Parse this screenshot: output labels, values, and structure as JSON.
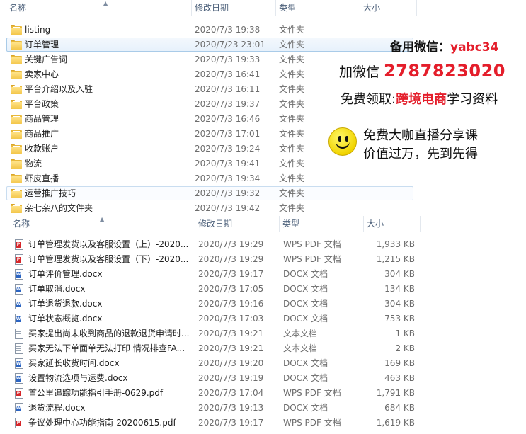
{
  "pane1": {
    "columns": {
      "name": "名称",
      "date": "修改日期",
      "type": "类型",
      "size": "大小"
    },
    "rows": [
      {
        "name": "listing",
        "date": "2020/7/3 19:38",
        "type": "文件夹",
        "state": "normal"
      },
      {
        "name": "订单管理",
        "date": "2020/7/23 23:01",
        "type": "文件夹",
        "state": "selected"
      },
      {
        "name": "关键广告词",
        "date": "2020/7/3 19:33",
        "type": "文件夹",
        "state": "normal"
      },
      {
        "name": "卖家中心",
        "date": "2020/7/3 16:41",
        "type": "文件夹",
        "state": "normal"
      },
      {
        "name": "平台介绍以及入驻",
        "date": "2020/7/3 16:11",
        "type": "文件夹",
        "state": "normal"
      },
      {
        "name": "平台政策",
        "date": "2020/7/3 19:37",
        "type": "文件夹",
        "state": "normal"
      },
      {
        "name": "商品管理",
        "date": "2020/7/3 16:46",
        "type": "文件夹",
        "state": "normal"
      },
      {
        "name": "商品推广",
        "date": "2020/7/3 17:01",
        "type": "文件夹",
        "state": "normal"
      },
      {
        "name": "收款账户",
        "date": "2020/7/3 19:24",
        "type": "文件夹",
        "state": "normal"
      },
      {
        "name": "物流",
        "date": "2020/7/3 19:41",
        "type": "文件夹",
        "state": "normal"
      },
      {
        "name": "虾皮直播",
        "date": "2020/7/3 19:34",
        "type": "文件夹",
        "state": "normal"
      },
      {
        "name": "运营推广技巧",
        "date": "2020/7/3 19:32",
        "type": "文件夹",
        "state": "highlight"
      },
      {
        "name": "杂七杂八的文件夹",
        "date": "2020/7/3 19:42",
        "type": "文件夹",
        "state": "normal"
      }
    ]
  },
  "pane2": {
    "columns": {
      "name": "名称",
      "date": "修改日期",
      "type": "类型",
      "size": "大小"
    },
    "rows": [
      {
        "name": "订单管理发货以及客服设置（上）-2020...",
        "date": "2020/7/3 19:29",
        "type": "WPS PDF 文档",
        "size": "1,933 KB",
        "icon": "pdf-icon"
      },
      {
        "name": "订单管理发货以及客服设置（下）-2020...",
        "date": "2020/7/3 19:29",
        "type": "WPS PDF 文档",
        "size": "1,215 KB",
        "icon": "pdf-icon"
      },
      {
        "name": "订单评价管理.docx",
        "date": "2020/7/3 19:17",
        "type": "DOCX 文档",
        "size": "304 KB",
        "icon": "word-icon"
      },
      {
        "name": "订单取消.docx",
        "date": "2020/7/3 17:05",
        "type": "DOCX 文档",
        "size": "134 KB",
        "icon": "word-icon"
      },
      {
        "name": "订单退货退款.docx",
        "date": "2020/7/3 19:16",
        "type": "DOCX 文档",
        "size": "304 KB",
        "icon": "word-icon"
      },
      {
        "name": "订单状态概览.docx",
        "date": "2020/7/3 17:03",
        "type": "DOCX 文档",
        "size": "753 KB",
        "icon": "word-icon"
      },
      {
        "name": "买家提出尚未收到商品的退款退货申请时...",
        "date": "2020/7/3 19:21",
        "type": "文本文档",
        "size": "1 KB",
        "icon": "text-icon"
      },
      {
        "name": "买家无法下单面单无法打印 情况排查FA...",
        "date": "2020/7/3 19:21",
        "type": "文本文档",
        "size": "2 KB",
        "icon": "text-icon"
      },
      {
        "name": "买家延长收货时间.docx",
        "date": "2020/7/3 19:20",
        "type": "DOCX 文档",
        "size": "169 KB",
        "icon": "word-icon"
      },
      {
        "name": "设置物流选项与运费.docx",
        "date": "2020/7/3 19:19",
        "type": "DOCX 文档",
        "size": "463 KB",
        "icon": "word-icon"
      },
      {
        "name": "首公里追踪功能指引手册-0629.pdf",
        "date": "2020/7/3 17:04",
        "type": "WPS PDF 文档",
        "size": "1,791 KB",
        "icon": "pdf-icon"
      },
      {
        "name": "退货流程.docx",
        "date": "2020/7/3 19:13",
        "type": "DOCX 文档",
        "size": "684 KB",
        "icon": "word-icon"
      },
      {
        "name": "争议处理中心功能指南-20200615.pdf",
        "date": "2020/7/3 19:17",
        "type": "WPS PDF 文档",
        "size": "1,619 KB",
        "icon": "pdf-icon"
      }
    ]
  },
  "overlay": {
    "line1_prefix": "备用微信：",
    "line1_id": "yabc34",
    "line2_prefix": "加微信",
    "line2_number": "2787823020",
    "line3_prefix": "免费领取:",
    "line3_highlight": "跨境电商",
    "line3_suffix": "学习资料",
    "line4": "免费大咖直播分享课",
    "line5": "价值过万，先到先得",
    "colors": {
      "accent": "#e41e2b",
      "text": "#111111",
      "smiley": "#f1d400"
    }
  }
}
